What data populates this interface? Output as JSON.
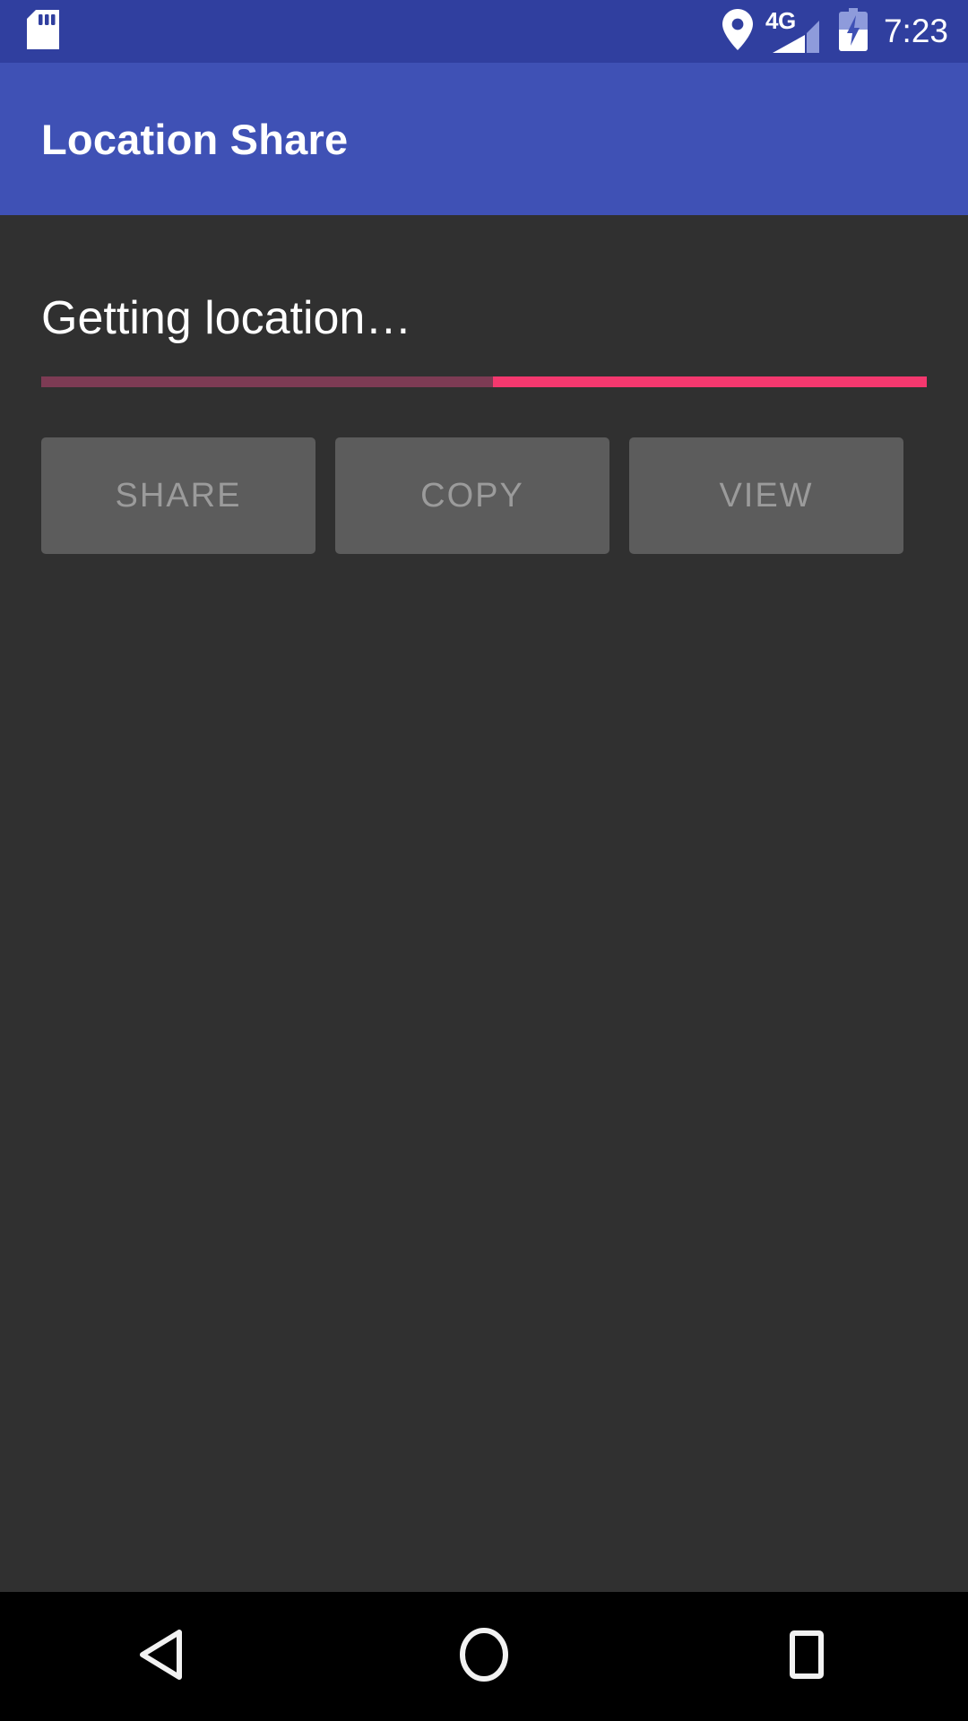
{
  "status_bar": {
    "background_color": "#303f9f",
    "left_icons": [
      {
        "name": "sd-card-icon",
        "label": "SD card"
      }
    ],
    "right_icons": [
      {
        "name": "location-pin-icon",
        "label": "Location"
      },
      {
        "name": "signal-bars-icon",
        "label": "Mobile signal"
      },
      {
        "name": "battery-charging-icon",
        "label": "Battery charging"
      }
    ],
    "network_type": "4G",
    "clock": "7:23"
  },
  "app_bar": {
    "title": "Location Share",
    "background_color": "#3f51b5",
    "text_color": "#ffffff"
  },
  "content": {
    "background_color": "#303030",
    "status_message": "Getting location…",
    "progress": {
      "indeterminate": true,
      "track_color": "#7d3b54",
      "indicator_color": "#f4386e",
      "indicator_start_percent": 51,
      "indicator_end_percent": 100
    },
    "buttons": [
      {
        "name": "share-button",
        "label": "SHARE",
        "enabled": false
      },
      {
        "name": "copy-button",
        "label": "COPY",
        "enabled": false
      },
      {
        "name": "view-button",
        "label": "VIEW",
        "enabled": false
      }
    ],
    "button_background_color": "#5c5c5c",
    "button_disabled_text_color": "#9b9b9b"
  },
  "nav_bar": {
    "background_color": "#000000",
    "buttons": [
      {
        "name": "nav-back-button",
        "icon": "back-triangle-icon",
        "label": "Back"
      },
      {
        "name": "nav-home-button",
        "icon": "home-circle-icon",
        "label": "Home"
      },
      {
        "name": "nav-recents-button",
        "icon": "recents-square-icon",
        "label": "Recents"
      }
    ]
  }
}
